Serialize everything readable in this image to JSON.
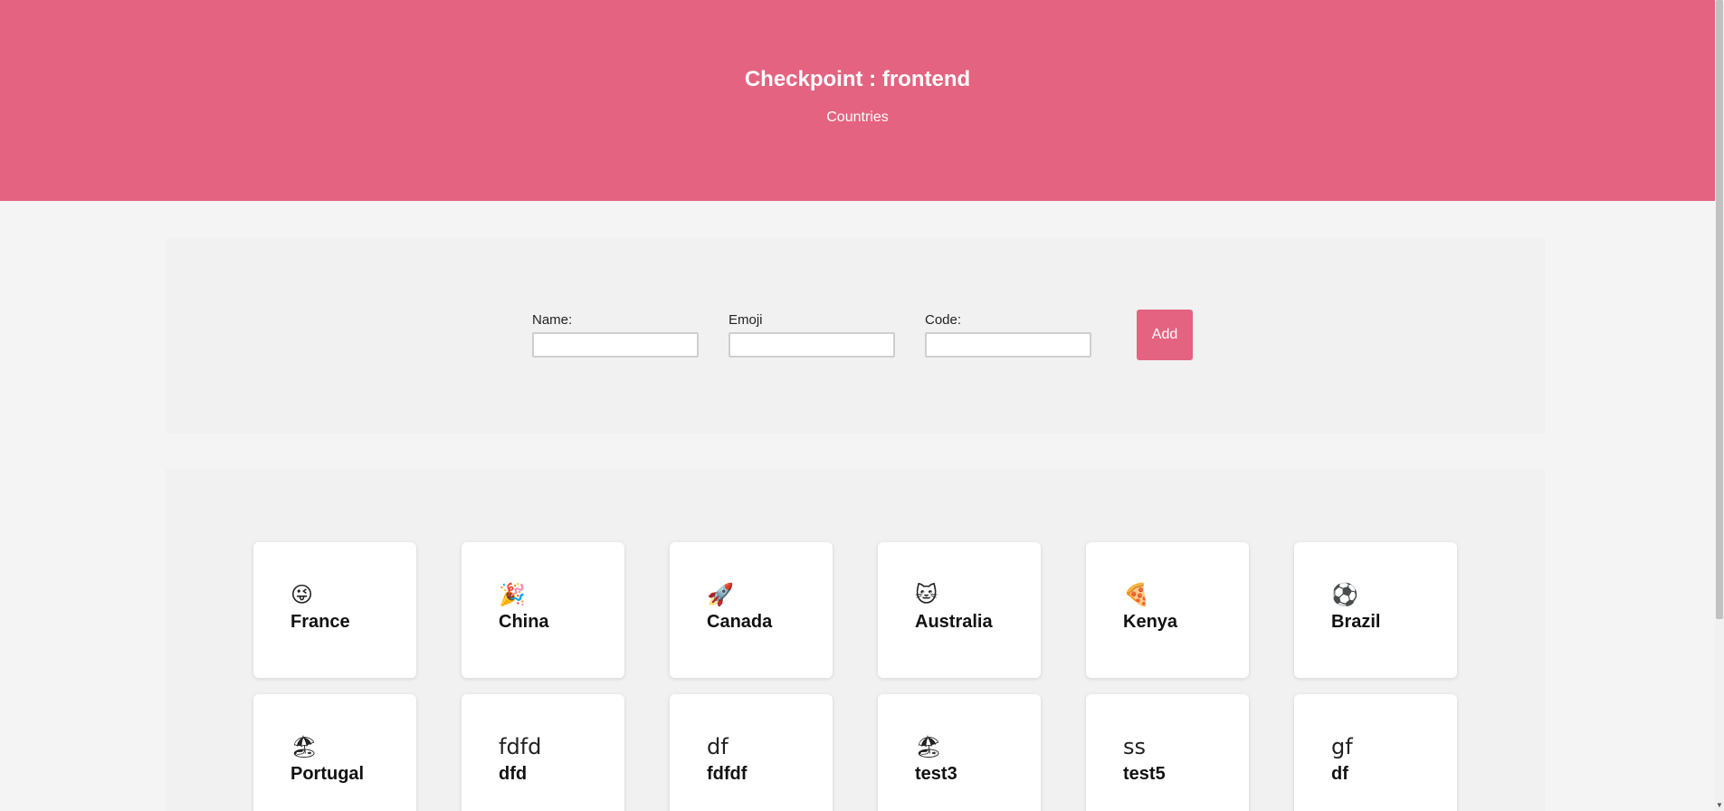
{
  "header": {
    "title": "Checkpoint : frontend",
    "subtitle": "Countries"
  },
  "form": {
    "name_label": "Name:",
    "emoji_label": "Emoji",
    "code_label": "Code:",
    "name_value": "",
    "emoji_value": "",
    "code_value": "",
    "add_label": "Add"
  },
  "cards": [
    {
      "emoji": "😜",
      "name": "France"
    },
    {
      "emoji": "🎉",
      "name": "China"
    },
    {
      "emoji": "🚀",
      "name": "Canada"
    },
    {
      "emoji": "🐱",
      "name": "Australia"
    },
    {
      "emoji": "🍕",
      "name": "Kenya"
    },
    {
      "emoji": "⚽",
      "name": "Brazil"
    },
    {
      "emoji": "🏖",
      "name": "Portugal"
    },
    {
      "emoji": "fdfd",
      "name": "dfd"
    },
    {
      "emoji": "df",
      "name": "fdfdf"
    },
    {
      "emoji": "🏖",
      "name": "test3"
    },
    {
      "emoji": "ss",
      "name": "test5"
    },
    {
      "emoji": "gf",
      "name": "df"
    }
  ],
  "colors": {
    "accent": "#e46380",
    "background": "#f4f4f4",
    "panel": "#f1f1f1",
    "card": "#ffffff"
  }
}
